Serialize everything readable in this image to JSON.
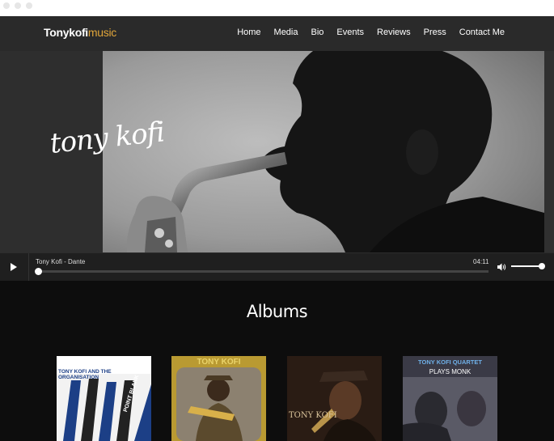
{
  "brand": {
    "name": "Tonykofi",
    "accent": "music"
  },
  "nav": [
    {
      "label": "Home"
    },
    {
      "label": "Media"
    },
    {
      "label": "Bio"
    },
    {
      "label": "Events"
    },
    {
      "label": "Reviews"
    },
    {
      "label": "Press"
    },
    {
      "label": "Contact Me"
    }
  ],
  "hero": {
    "title": "tony kofi"
  },
  "player": {
    "track": "Tony Kofi - Dante",
    "time": "04:11",
    "progress": 0,
    "volume": 1.0
  },
  "albums": {
    "heading": "Albums",
    "items": [
      {
        "cover_text": "TONY KOFI AND THE ORGANISATION",
        "spine_text": "POINT BLANK"
      },
      {
        "cover_text": "TONY KOFI"
      },
      {
        "cover_text": "TONY KOFI"
      },
      {
        "cover_text": "TONY KOFI QUARTET",
        "subtitle": "PLAYS MONK"
      }
    ]
  },
  "colors": {
    "nav_bg": "#2a2a2a",
    "accent": "#e0a53a",
    "page_bg": "#0d0d0d"
  }
}
